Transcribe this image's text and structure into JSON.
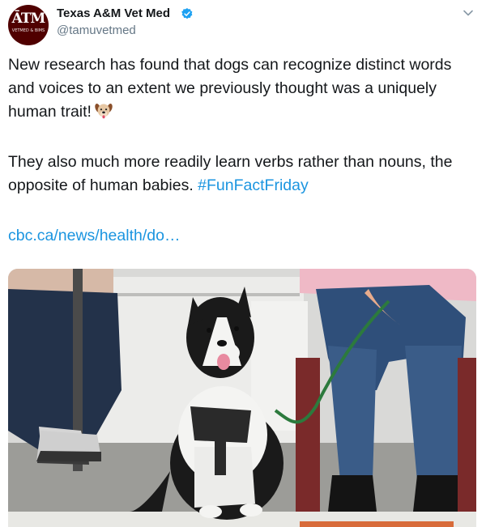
{
  "author": {
    "display_name": "Texas A&M Vet Med",
    "handle": "@tamuvetmed",
    "avatar_logo": "ĀTM",
    "avatar_sub": "VETMED & BIMS",
    "verified": true
  },
  "tweet": {
    "paragraph1": "New research has found that dogs can recognize distinct words and voices to an extent we previously thought was a uniquely human trait!",
    "paragraph2_text": "They also much more readily learn verbs rather than nouns, the opposite of human babies.",
    "hashtag": "#FunFactFriday",
    "link": "cbc.ca/news/health/do…",
    "emoji": "dog-face-icon"
  },
  "icons": {
    "verified": "verified-badge-icon",
    "menu": "chevron-down-icon"
  },
  "colors": {
    "link": "#1b95e0",
    "secondary_text": "#657786",
    "avatar_bg": "#500000"
  }
}
